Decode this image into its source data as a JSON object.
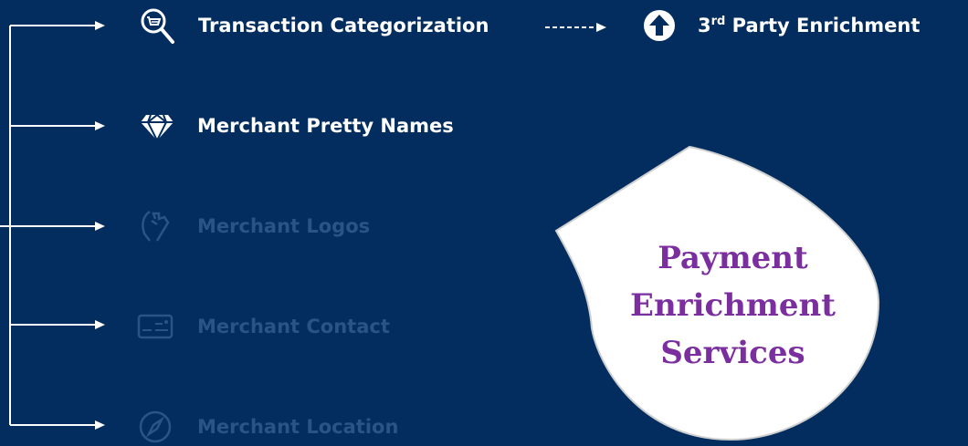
{
  "colors": {
    "background": "#022d5e",
    "active": "#ffffff",
    "inactive": "#2b5486",
    "callout_text": "#7b2f9e"
  },
  "services": [
    {
      "label": "Transaction Categorization",
      "icon": "search-category-icon",
      "state": "active"
    },
    {
      "label": "Merchant Pretty Names",
      "icon": "diamond-icon",
      "state": "active"
    },
    {
      "label": "Merchant Logos",
      "icon": "logo-hands-icon",
      "state": "inactive"
    },
    {
      "label": "Merchant Contact",
      "icon": "contact-card-icon",
      "state": "inactive"
    },
    {
      "label": "Merchant Location",
      "icon": "compass-icon",
      "state": "inactive"
    }
  ],
  "enrichment": {
    "prefix": "3",
    "superscript": "rd",
    "rest": " Party Enrichment",
    "icon": "arrow-up-circle-icon"
  },
  "callout": {
    "lines": [
      "Payment",
      "Enrichment",
      "Services"
    ]
  }
}
